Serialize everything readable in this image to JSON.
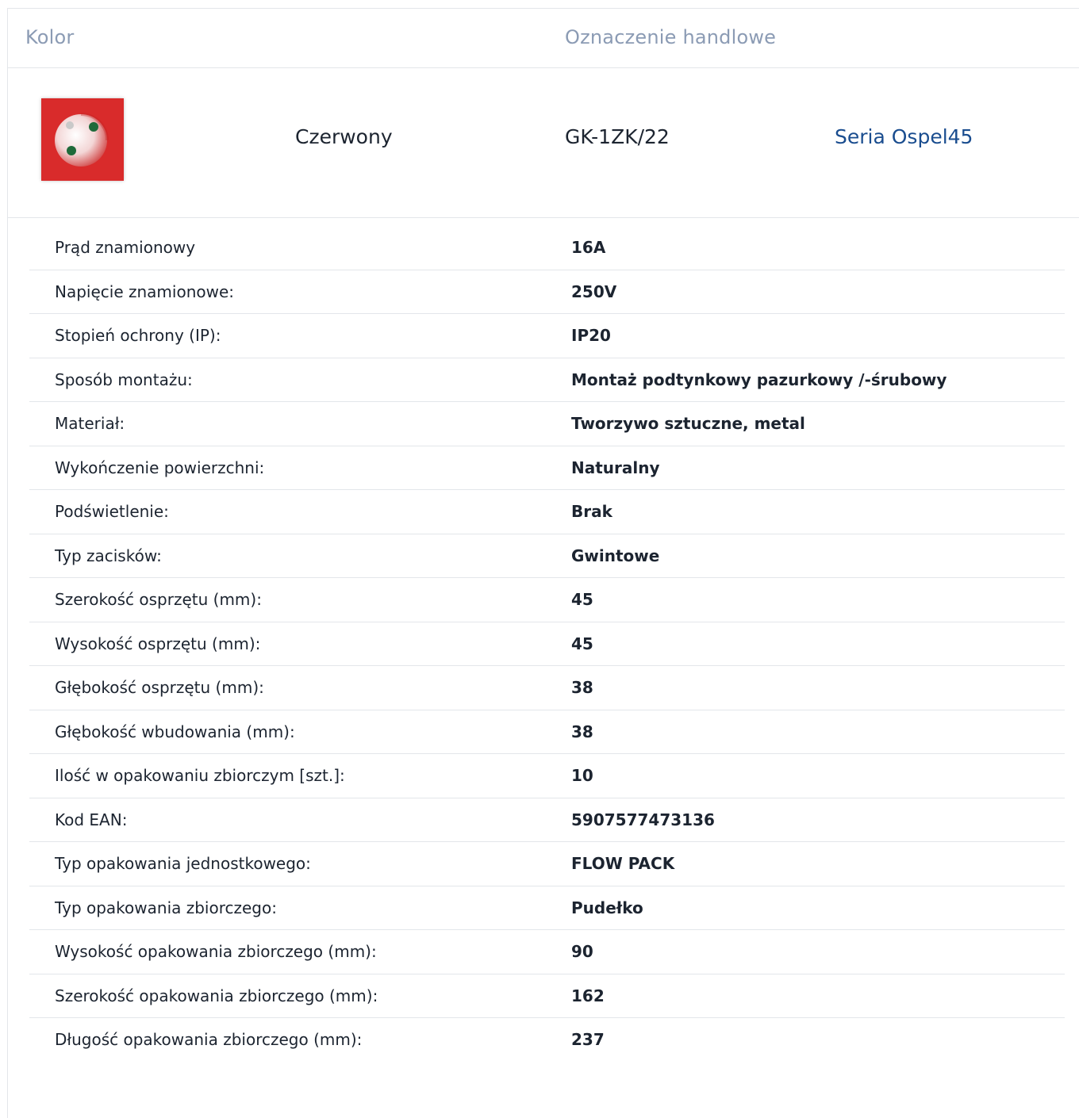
{
  "header": {
    "color_label": "Kolor",
    "trade_label": "Oznaczenie handlowe"
  },
  "product": {
    "color": "Czerwony",
    "trade_name": "GK-1ZK/22",
    "series_link": "Seria Ospel45",
    "thumbnail_color": "#d92b2b",
    "thumbnail_icon": "red-socket-icon"
  },
  "specs": [
    {
      "label": "Prąd znamionowy",
      "value": "16A"
    },
    {
      "label": "Napięcie znamionowe:",
      "value": "250V"
    },
    {
      "label": "Stopień ochrony (IP):",
      "value": "IP20"
    },
    {
      "label": "Sposób montażu:",
      "value": "Montaż podtynkowy pazurkowy /-śrubowy"
    },
    {
      "label": "Materiał:",
      "value": "Tworzywo sztuczne, metal"
    },
    {
      "label": "Wykończenie powierzchni:",
      "value": "Naturalny"
    },
    {
      "label": "Podświetlenie:",
      "value": "Brak"
    },
    {
      "label": "Typ zacisków:",
      "value": "Gwintowe"
    },
    {
      "label": "Szerokość osprzętu (mm):",
      "value": "45"
    },
    {
      "label": "Wysokość osprzętu (mm):",
      "value": "45"
    },
    {
      "label": "Głębokość osprzętu (mm):",
      "value": "38"
    },
    {
      "label": "Głębokość wbudowania (mm):",
      "value": "38"
    },
    {
      "label": "Ilość w opakowaniu zbiorczym [szt.]:",
      "value": "10"
    },
    {
      "label": "Kod EAN:",
      "value": "5907577473136"
    },
    {
      "label": "Typ opakowania jednostkowego:",
      "value": "FLOW PACK"
    },
    {
      "label": "Typ opakowania zbiorczego:",
      "value": "Pudełko"
    },
    {
      "label": "Wysokość opakowania zbiorczego (mm):",
      "value": "90"
    },
    {
      "label": "Szerokość opakowania zbiorczego (mm):",
      "value": "162"
    },
    {
      "label": "Długość opakowania zbiorczego (mm):",
      "value": "237"
    }
  ]
}
